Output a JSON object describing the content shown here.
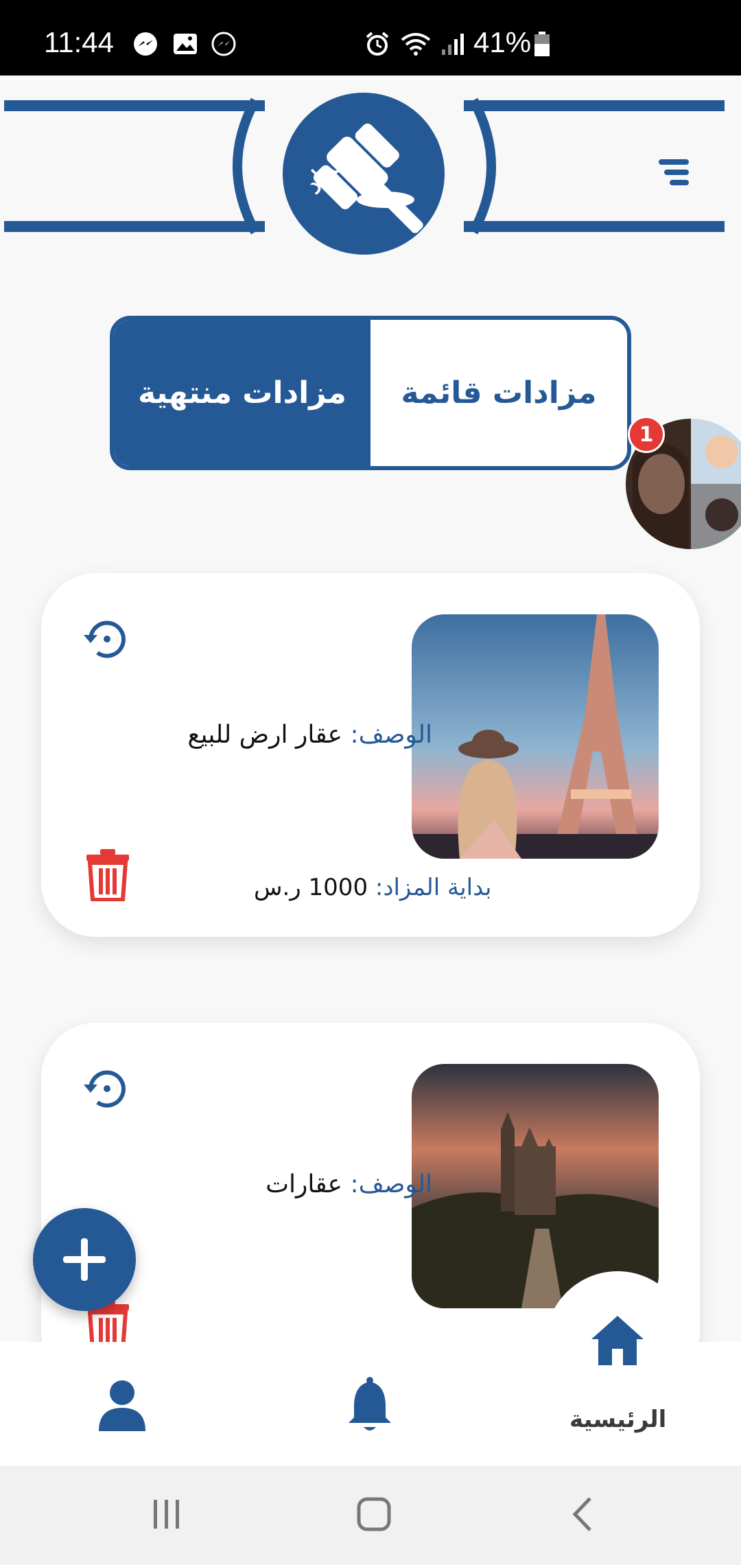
{
  "status_bar": {
    "time": "11:44",
    "battery_percent": "41%"
  },
  "header": {
    "logo_text": "مزاد"
  },
  "tabs": {
    "ongoing_label": "مزادات قائمة",
    "ended_label": "مزادات منتهية"
  },
  "chat_head": {
    "badge": "1"
  },
  "auctions": [
    {
      "description_label": "الوصف:",
      "description_value": "عقار ارض للبيع",
      "start_label": "بداية المزاد:",
      "start_value": "1000 ر.س",
      "image": "eiffel-tower-photo"
    },
    {
      "description_label": "الوصف:",
      "description_value": "عقارات",
      "image": "castle-photo"
    }
  ],
  "bottom_nav": {
    "home_label": "الرئيسية"
  },
  "colors": {
    "brand": "#255995",
    "danger": "#e53935"
  }
}
